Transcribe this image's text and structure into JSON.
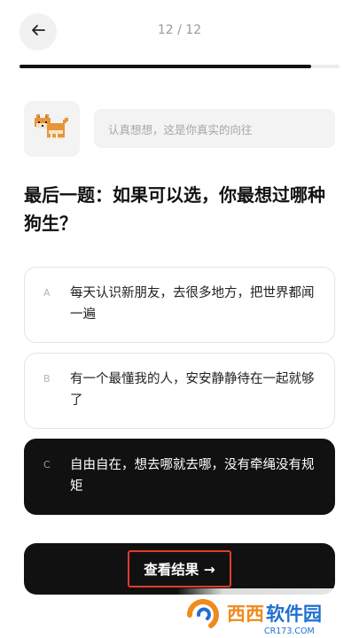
{
  "header": {
    "progress_text": "12 / 12",
    "progress_fraction": 0.91,
    "back_icon": "arrow-left-icon"
  },
  "mascot": {
    "icon": "shiba-dog-pixel-icon"
  },
  "hint": {
    "text": "认真想想，这是你真实的向往"
  },
  "question": {
    "title": "最后一题：如果可以选，你最想过哪种狗生？"
  },
  "options": [
    {
      "letter": "A",
      "text": "每天认识新朋友，去很多地方，把世界都闻一遍",
      "selected": false
    },
    {
      "letter": "B",
      "text": "有一个最懂我的人，安安静静待在一起就够了",
      "selected": false
    },
    {
      "letter": "C",
      "text": "自由自在，想去哪就去哪，没有牵绳没有规矩",
      "selected": true
    }
  ],
  "result_button": {
    "label": "查看结果 →"
  },
  "watermark": {
    "brand": "西西软件园",
    "domain": "CR173.COM"
  },
  "colors": {
    "accent": "#111111",
    "highlight_border": "#e23b2c",
    "watermark_orange": "#f08a1c",
    "watermark_blue": "#1f6fd1"
  }
}
